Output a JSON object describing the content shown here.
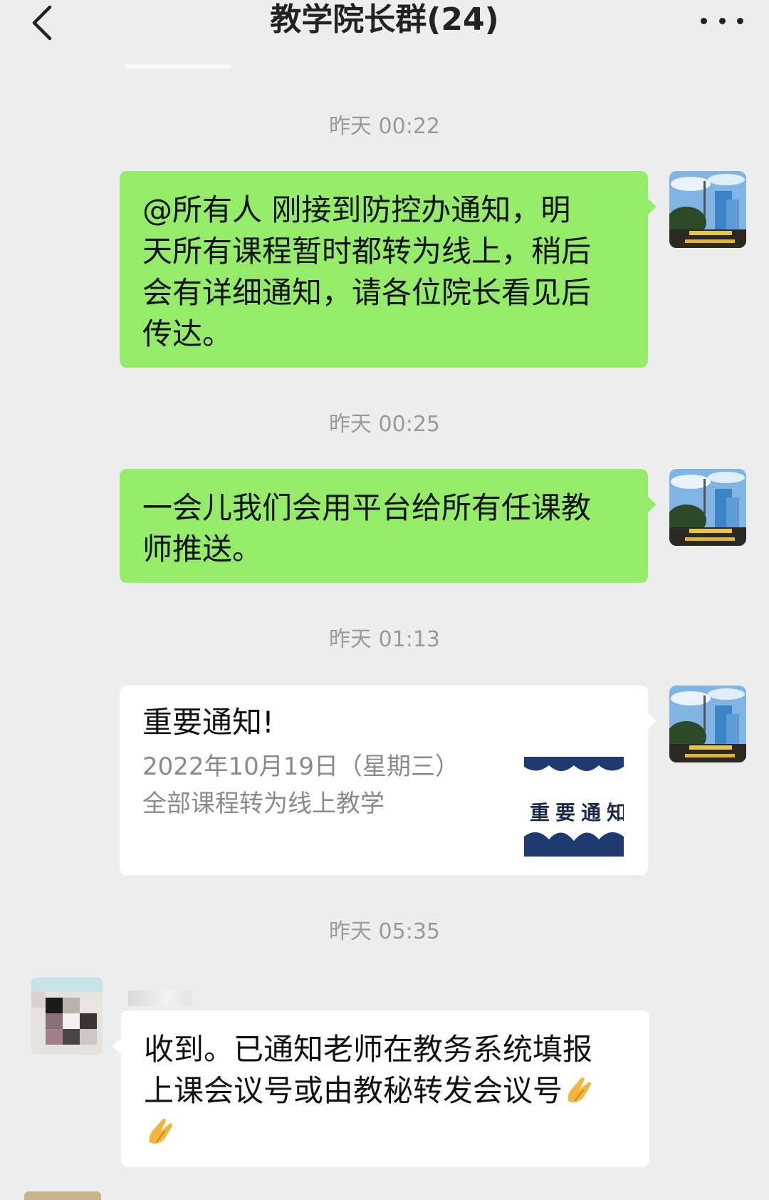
{
  "header": {
    "title": "教学院长群(24)",
    "back_icon": "chevron-left-icon",
    "more_icon": "more-dots-icon"
  },
  "messages": [
    {
      "timestamp": "昨天 00:22",
      "sender": "me",
      "type": "text",
      "lines": [
        "@所有人  刚接到防控办通知，明",
        "天所有课程暂时都转为线上，稍后",
        "会有详细通知，请各位院长看见后",
        "传达。"
      ]
    },
    {
      "timestamp": "昨天 00:25",
      "sender": "me",
      "type": "text",
      "lines": [
        "一会儿我们会用平台给所有任课教",
        "师推送。"
      ]
    },
    {
      "timestamp": "昨天 01:13",
      "sender": "me",
      "type": "link-card",
      "card": {
        "title": "重要通知!",
        "desc_lines": [
          "2022年10月19日（星期三）",
          "全部课程转为线上教学"
        ],
        "thumb_text": "重要通知"
      }
    },
    {
      "timestamp": "昨天 05:35",
      "sender": "other",
      "type": "text",
      "lines": [
        "收到。已通知老师在教务系统填报",
        "上课会议号或由教秘转发会议号"
      ]
    }
  ],
  "colors": {
    "background": "#ededed",
    "my_bubble": "#95ec69",
    "other_bubble": "#ffffff",
    "timestamp": "#9a9a9a"
  }
}
